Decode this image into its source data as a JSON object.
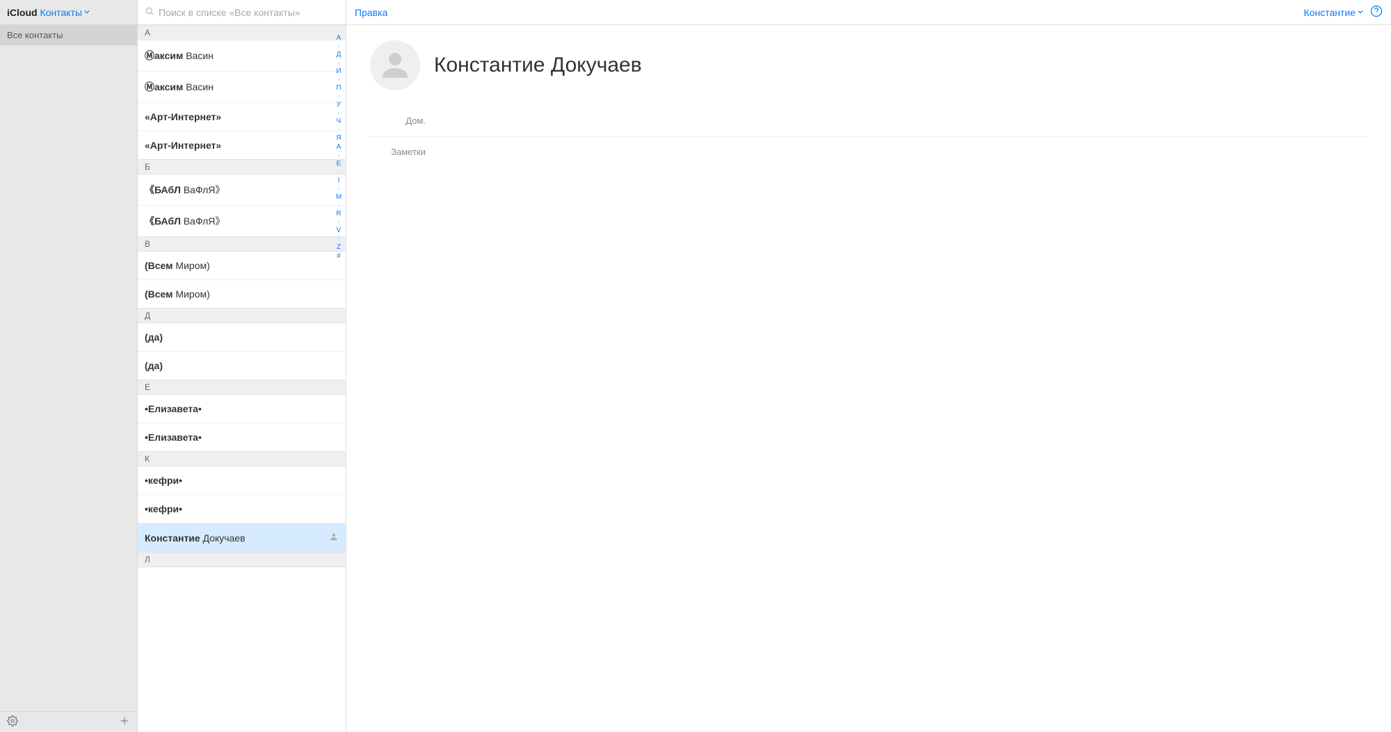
{
  "header": {
    "brand": "iCloud",
    "app_name": "Контакты"
  },
  "sidebar": {
    "groups": [
      {
        "label": "Все контакты",
        "selected": true
      }
    ]
  },
  "search": {
    "placeholder": "Поиск в списке «Все контакты»"
  },
  "sections": [
    {
      "letter": "А",
      "items": [
        {
          "bold": "Ⓜаксим",
          "rest": " Васин"
        },
        {
          "bold": "Ⓜаксим",
          "rest": " Васин"
        },
        {
          "bold": "«Арт-Интернет»",
          "rest": ""
        },
        {
          "bold": "«Арт-Интернет»",
          "rest": ""
        }
      ]
    },
    {
      "letter": "Б",
      "items": [
        {
          "bold": "《БАбЛ",
          "rest": " ВаФлЯ》"
        },
        {
          "bold": "《БАбЛ",
          "rest": " ВаФлЯ》"
        }
      ]
    },
    {
      "letter": "В",
      "items": [
        {
          "bold": "(Всем",
          "rest": " Миром)"
        },
        {
          "bold": "(Всем",
          "rest": " Миром)"
        }
      ]
    },
    {
      "letter": "Д",
      "items": [
        {
          "bold": "(да)",
          "rest": ""
        },
        {
          "bold": "(да)",
          "rest": ""
        }
      ]
    },
    {
      "letter": "Е",
      "items": [
        {
          "bold": "•Елизавета•",
          "rest": ""
        },
        {
          "bold": "•Елизавета•",
          "rest": ""
        }
      ]
    },
    {
      "letter": "К",
      "items": [
        {
          "bold": "•кефри•",
          "rest": ""
        },
        {
          "bold": "•кефри•",
          "rest": ""
        },
        {
          "bold": "Константие",
          "rest": " Докучаев",
          "selected": true,
          "badge": "person"
        }
      ]
    },
    {
      "letter": "Л",
      "items": []
    }
  ],
  "alpha_index": [
    "А",
    "•",
    "Д",
    "•",
    "И",
    "•",
    "П",
    "•",
    "У",
    "•",
    "Ч",
    "•",
    "Я",
    "A",
    "•",
    "E",
    "•",
    "I",
    "•",
    "M",
    "•",
    "R",
    "•",
    "V",
    "•",
    "Z",
    "#"
  ],
  "detail": {
    "edit_label": "Правка",
    "account_name": "Константие",
    "title_first": "Константие",
    "title_last": "Докучаев",
    "fields": [
      {
        "label": "Дом.",
        "value": ""
      },
      {
        "label": "Заметки",
        "value": ""
      }
    ]
  }
}
